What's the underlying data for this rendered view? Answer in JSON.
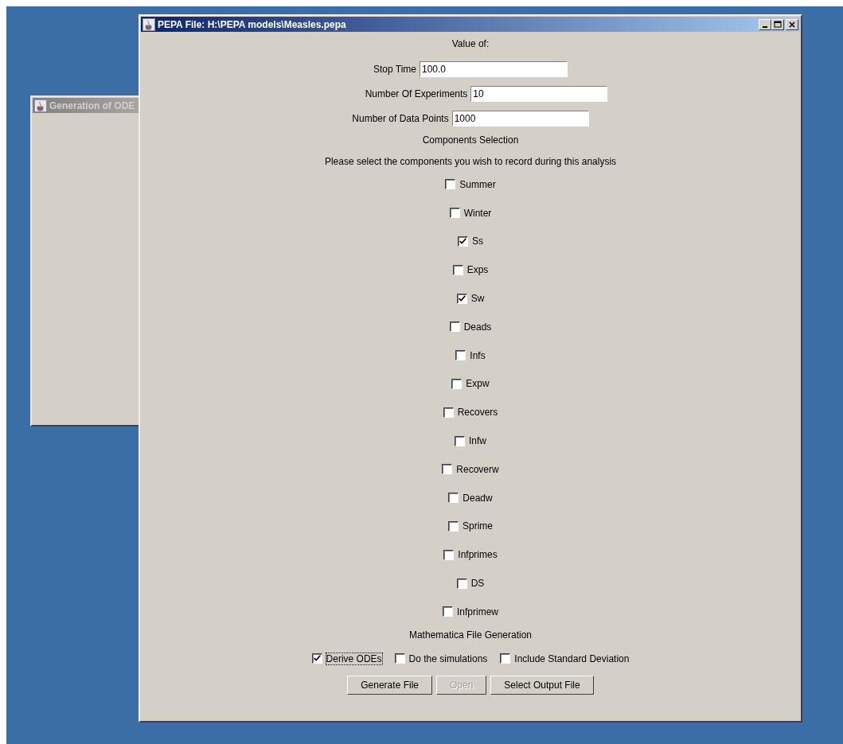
{
  "background_window": {
    "title": "Generation of ODE"
  },
  "window": {
    "title": "PEPA File: H:\\PEPA models\\Measles.pepa"
  },
  "heading": "Value of:",
  "fields": [
    {
      "label": "Stop Time",
      "value": "100.0"
    },
    {
      "label": "Number Of Experiments",
      "value": "10"
    },
    {
      "label": "Number of Data Points",
      "value": "1000"
    }
  ],
  "components_title": "Components Selection",
  "components_hint": "Please select the components you wish to record during this analysis",
  "components": [
    {
      "label": "Summer",
      "checked": false
    },
    {
      "label": "Winter",
      "checked": false
    },
    {
      "label": "Ss",
      "checked": true
    },
    {
      "label": "Exps",
      "checked": false
    },
    {
      "label": "Sw",
      "checked": true
    },
    {
      "label": "Deads",
      "checked": false
    },
    {
      "label": "Infs",
      "checked": false
    },
    {
      "label": "Expw",
      "checked": false
    },
    {
      "label": "Recovers",
      "checked": false
    },
    {
      "label": "Infw",
      "checked": false
    },
    {
      "label": "Recoverw",
      "checked": false
    },
    {
      "label": "Deadw",
      "checked": false
    },
    {
      "label": "Sprime",
      "checked": false
    },
    {
      "label": "Infprimes",
      "checked": false
    },
    {
      "label": "DS",
      "checked": false
    },
    {
      "label": "Infprimew",
      "checked": false
    }
  ],
  "generation_title": "Mathematica File Generation",
  "options": [
    {
      "label": "Derive ODEs",
      "checked": true,
      "focused": true
    },
    {
      "label": "Do the simulations",
      "checked": false,
      "focused": false
    },
    {
      "label": "Include Standard Deviation",
      "checked": false,
      "focused": false
    }
  ],
  "buttons": [
    {
      "label": "Generate File",
      "disabled": false
    },
    {
      "label": "Open",
      "disabled": true
    },
    {
      "label": "Select Output File",
      "disabled": false
    }
  ]
}
